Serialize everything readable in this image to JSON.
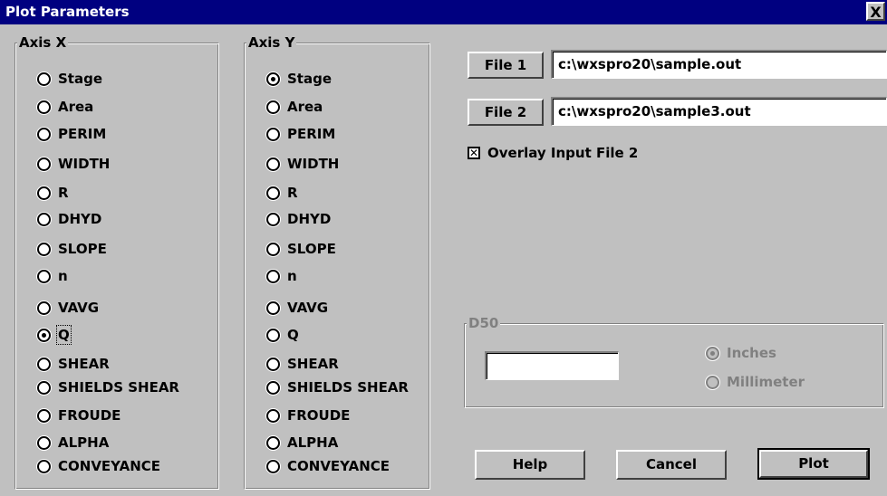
{
  "window": {
    "title": "Plot Parameters",
    "close_label": "X"
  },
  "axis_x": {
    "legend": "Axis X",
    "options": [
      "Stage",
      "Area",
      "PERIM",
      "WIDTH",
      "R",
      "DHYD",
      "SLOPE",
      "n",
      "VAVG",
      "Q",
      "SHEAR",
      "SHIELDS SHEAR",
      "FROUDE",
      "ALPHA",
      "CONVEYANCE"
    ],
    "selected": "Q"
  },
  "axis_y": {
    "legend": "Axis Y",
    "options": [
      "Stage",
      "Area",
      "PERIM",
      "WIDTH",
      "R",
      "DHYD",
      "SLOPE",
      "n",
      "VAVG",
      "Q",
      "SHEAR",
      "SHIELDS SHEAR",
      "FROUDE",
      "ALPHA",
      "CONVEYANCE"
    ],
    "selected": "Stage"
  },
  "files": {
    "file1_label": "File 1",
    "file1_value": "c:\\wxspro20\\sample.out",
    "file2_label": "File 2",
    "file2_value": "c:\\wxspro20\\sample3.out"
  },
  "overlay": {
    "label": "Overlay Input File 2",
    "checked": true
  },
  "d50": {
    "legend": "D50",
    "value": "",
    "inches_label": "Inches",
    "millimeter_label": "Millimeter",
    "selected": "Inches"
  },
  "buttons": {
    "help": "Help",
    "cancel": "Cancel",
    "plot": "Plot"
  }
}
